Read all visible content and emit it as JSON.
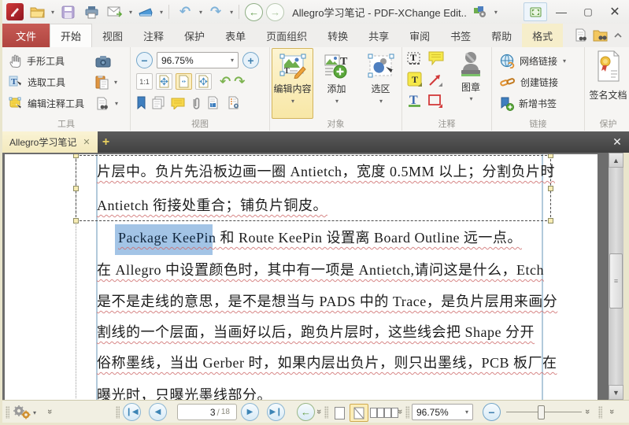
{
  "titlebar": {
    "title": "Allegro学习笔记 - PDF-XChange Edit.."
  },
  "ribbon_tabs": [
    "文件",
    "开始",
    "视图",
    "注释",
    "保护",
    "表单",
    "页面组织",
    "转换",
    "共享",
    "审阅",
    "书签",
    "帮助",
    "格式"
  ],
  "ribbon": {
    "tools": {
      "label": "工具",
      "hand_tool": "手形工具",
      "select_tool": "选取工具",
      "edit_comment_tool": "编辑注释工具"
    },
    "view": {
      "label": "视图",
      "zoom_value": "96.75%",
      "actual_size": "1:1"
    },
    "objects": {
      "label": "对象",
      "edit_content": "编辑内容",
      "add": "添加",
      "selection": "选区"
    },
    "comments": {
      "label": "注释",
      "stamp": "图章"
    },
    "links": {
      "label": "链接",
      "web_link": "网络链接",
      "create_link": "创建链接",
      "add_bookmark": "新增书签"
    },
    "protect": {
      "label": "保护",
      "sign_document": "签名文档"
    }
  },
  "doc_tab": {
    "title": "Allegro学习笔记"
  },
  "document": {
    "line1": "片层中。负片先沿板边画一圈 Antietch，宽度 0.5MM 以上；分割负片时",
    "line2": "Antietch 衔接处重合；铺负片铜皮。",
    "line3_highlight": "Package KeePin",
    "line3_rest": " 和 Route KeePin 设置离 Board Outline 远一点。",
    "line4": "在 Allegro 中设置颜色时，其中有一项是 Antietch,请问这是什么，Etch",
    "line5": "是不是走线的意思，是不是想当与 PADS 中的 Trace，是负片层用来画分",
    "line6": "割线的一个层面，当画好以后，跑负片层时，这些线会把 Shape 分开",
    "line7": "俗称墨线，当出 Gerber 时，如果内层出负片，则只出墨线，PCB 板厂在",
    "line8": "曝光时，只曝光墨线部分。"
  },
  "statusbar": {
    "page_current": "3",
    "page_separator": "/",
    "page_total": "18",
    "zoom_value": "96.75%"
  }
}
